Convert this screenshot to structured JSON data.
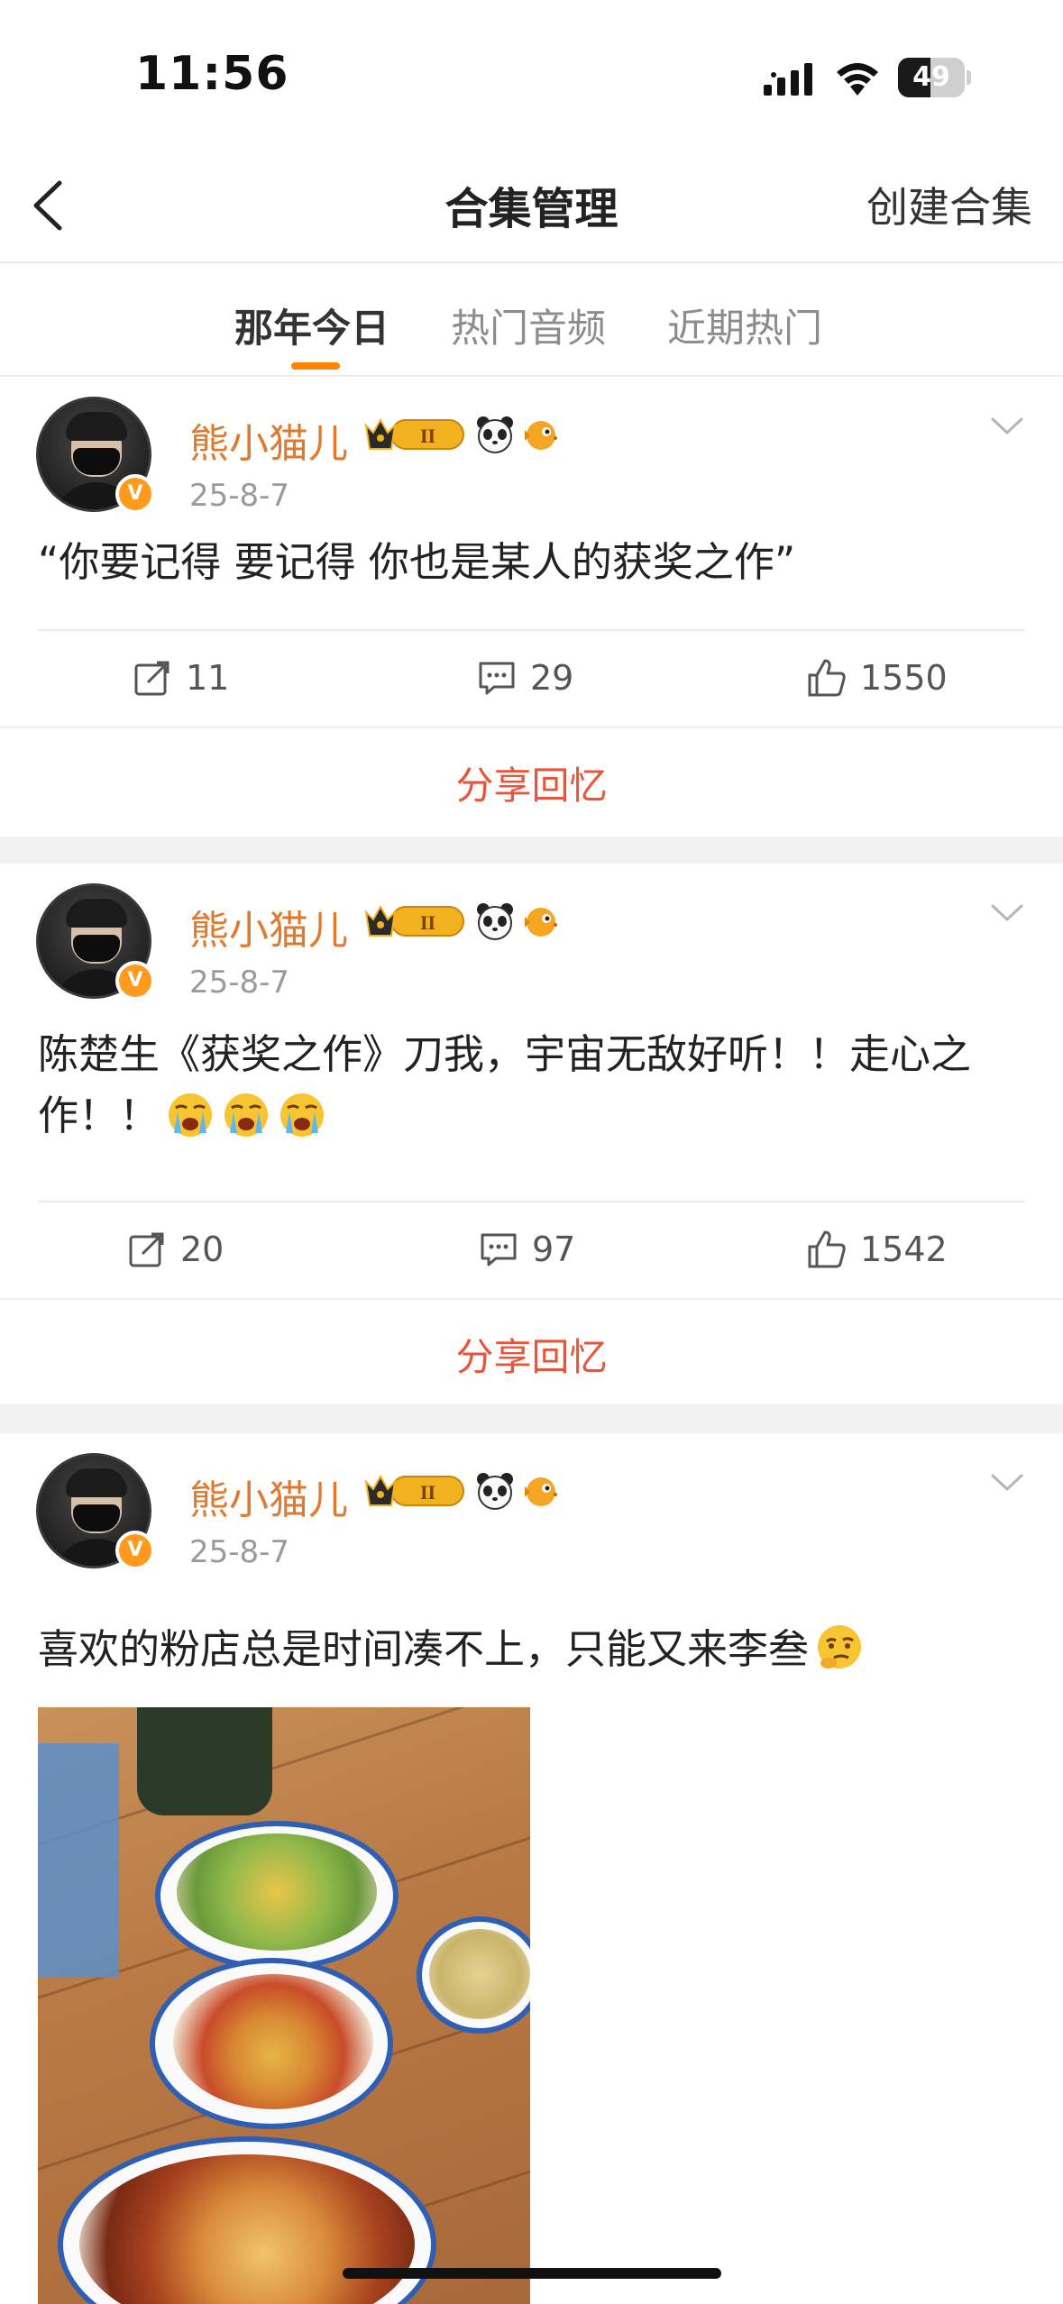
{
  "status_bar": {
    "time": "11:56",
    "battery": "49",
    "battery_level": 0.49
  },
  "nav": {
    "title": "合集管理",
    "action": "创建合集",
    "back_icon": "chevron-left-icon"
  },
  "tabs": [
    {
      "label": "那年今日",
      "active": true
    },
    {
      "label": "热门音频",
      "active": false
    },
    {
      "label": "近期热门",
      "active": false
    }
  ],
  "accent_color": "#ff8200",
  "share_color": "#e8553a",
  "posts": [
    {
      "username": "熊小猫儿",
      "date": "25-8-7",
      "text": "“你要记得 要记得 你也是某人的获奖之作”",
      "reposts": "11",
      "comments": "29",
      "likes": "1550",
      "share_label": "分享回忆"
    },
    {
      "username": "熊小猫儿",
      "date": "25-8-7",
      "text": "陈楚生《获奖之作》刀我，宇宙无敌好听！！走心之作！！",
      "emoji": "crying-face-icon",
      "reposts": "20",
      "comments": "97",
      "likes": "1542",
      "share_label": "分享回忆"
    },
    {
      "username": "熊小猫儿",
      "date": "25-8-7",
      "text": "喜欢的粉店总是时间凑不上，只能又来李叁",
      "emoji": "thinking-face-icon",
      "image": "food-photo"
    }
  ]
}
